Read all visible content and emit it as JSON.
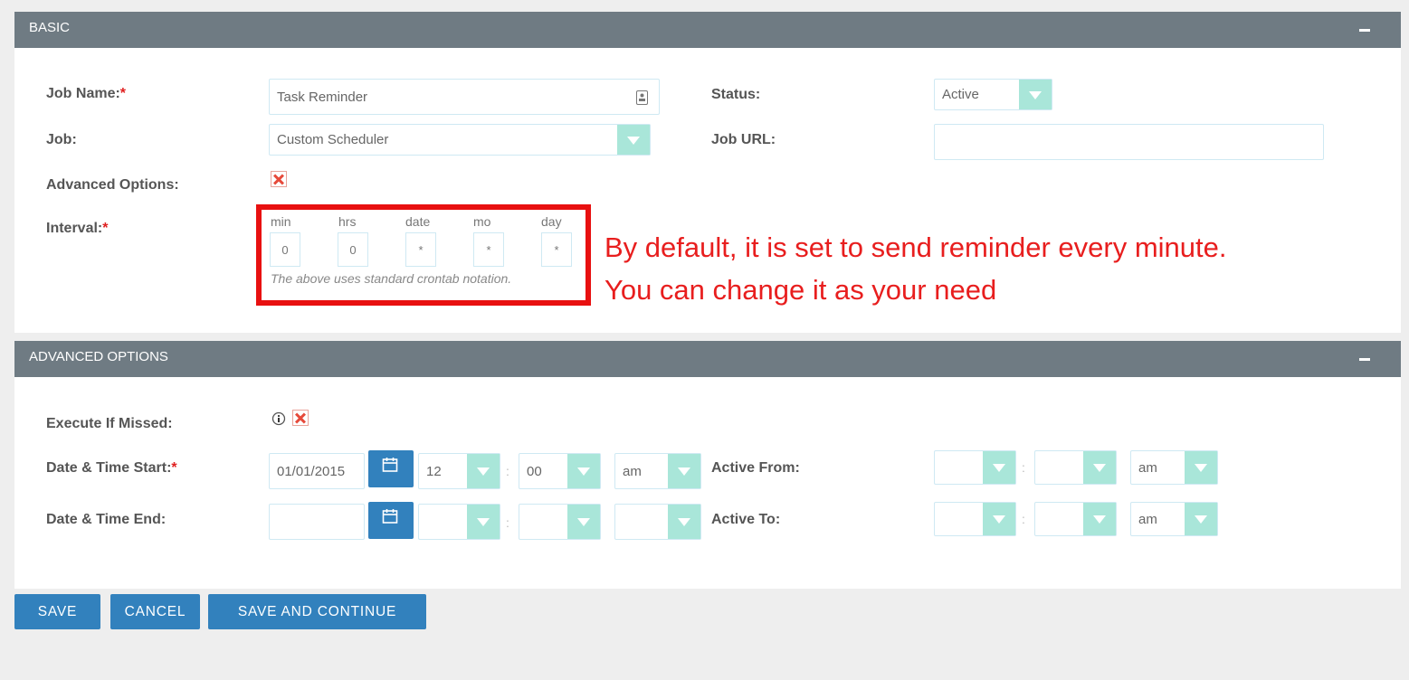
{
  "basic": {
    "title": "BASIC",
    "job_name_label": "Job Name:",
    "job_name_value": "Task Reminder",
    "job_label": "Job:",
    "job_value": "Custom Scheduler",
    "advanced_options_label": "Advanced Options:",
    "interval_label": "Interval:",
    "status_label": "Status:",
    "status_value": "Active",
    "job_url_label": "Job URL:",
    "job_url_value": "",
    "required_mark": "*",
    "cron": {
      "labels": [
        "min",
        "hrs",
        "date",
        "mo",
        "day"
      ],
      "values": [
        "0",
        "0",
        "*",
        "*",
        "*"
      ],
      "note": "The above uses standard crontab notation."
    }
  },
  "annotation": {
    "line1": "By default, it is set to send reminder every minute.",
    "line2": "You can change it as your need",
    "color": "#e81e1e"
  },
  "advanced": {
    "title": "ADVANCED OPTIONS",
    "execute_if_missed_label": "Execute If Missed:",
    "start_label": "Date & Time Start:",
    "end_label": "Date & Time End:",
    "active_from_label": "Active From:",
    "active_to_label": "Active To:",
    "start_date": "01/01/2015",
    "start_hour": "12",
    "start_minute": "00",
    "start_ampm": "am",
    "end_date": "",
    "end_hour": "",
    "end_minute": "",
    "end_ampm": "",
    "active_from_hour": "",
    "active_from_minute": "",
    "active_from_ampm": "am",
    "active_to_hour": "",
    "active_to_minute": "",
    "active_to_ampm": "am",
    "time_separator": ":"
  },
  "buttons": {
    "save": "SAVE",
    "cancel": "CANCEL",
    "save_continue": "SAVE AND CONTINUE"
  },
  "colors": {
    "header": "#6f7b83",
    "primary_button": "#3281bd",
    "select_arrow": "#a9e6d9",
    "required": "#e02020"
  }
}
